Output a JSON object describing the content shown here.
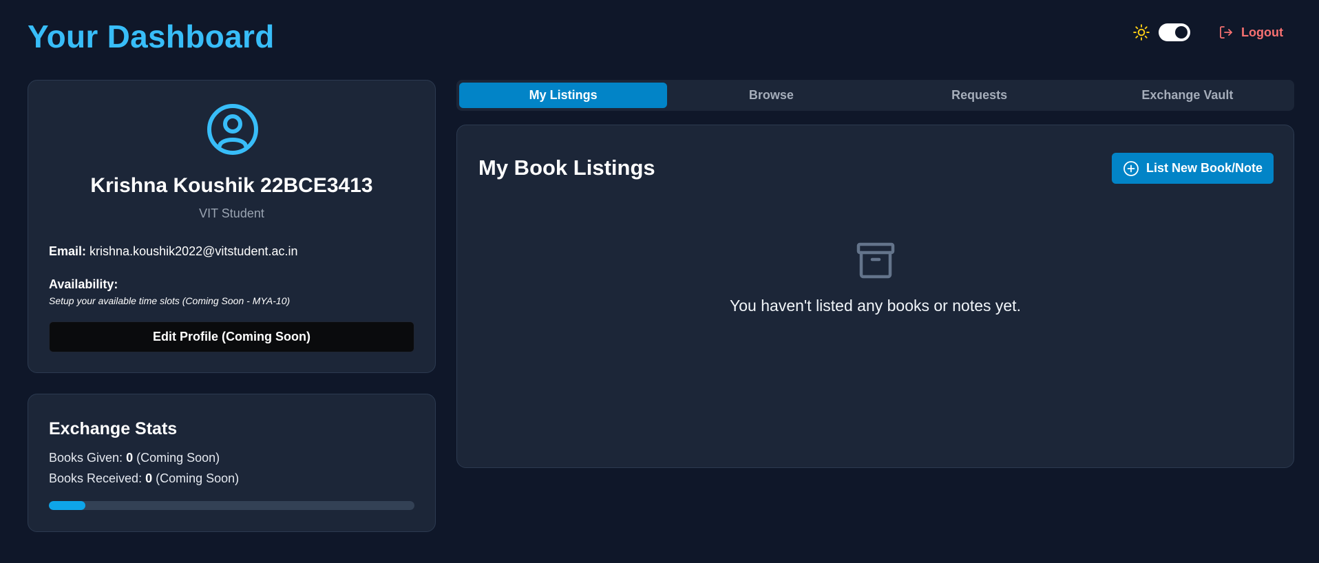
{
  "header": {
    "title": "Your Dashboard",
    "theme_toggle_state": "dark",
    "logout_label": "Logout"
  },
  "profile": {
    "name": "Krishna Koushik 22BCE3413",
    "role": "VIT Student",
    "email_label": "Email:",
    "email": "krishna.koushik2022@vitstudent.ac.in",
    "availability_label": "Availability:",
    "availability_note": "Setup your available time slots (Coming Soon - MYA-10)",
    "edit_button": "Edit Profile (Coming Soon)",
    "avatar_icon": "user-circle-icon"
  },
  "stats": {
    "title": "Exchange Stats",
    "given_label": "Books Given:",
    "given_value": "0",
    "given_note": "(Coming Soon)",
    "received_label": "Books Received:",
    "received_value": "0",
    "received_note": "(Coming Soon)",
    "progress_fraction": 0.1
  },
  "tabs": [
    {
      "label": "My Listings",
      "active": true
    },
    {
      "label": "Browse",
      "active": false
    },
    {
      "label": "Requests",
      "active": false
    },
    {
      "label": "Exchange Vault",
      "active": false
    }
  ],
  "listings": {
    "title": "My Book Listings",
    "new_button": "List New Book/Note",
    "empty_icon": "archive-box-icon",
    "empty_text": "You haven't listed any books or notes yet."
  },
  "colors": {
    "accent": "#0284c7",
    "title": "#38bdf8",
    "logout": "#f87171",
    "sun": "#facc15",
    "background": "#0f1729",
    "card": "#1c2638"
  }
}
